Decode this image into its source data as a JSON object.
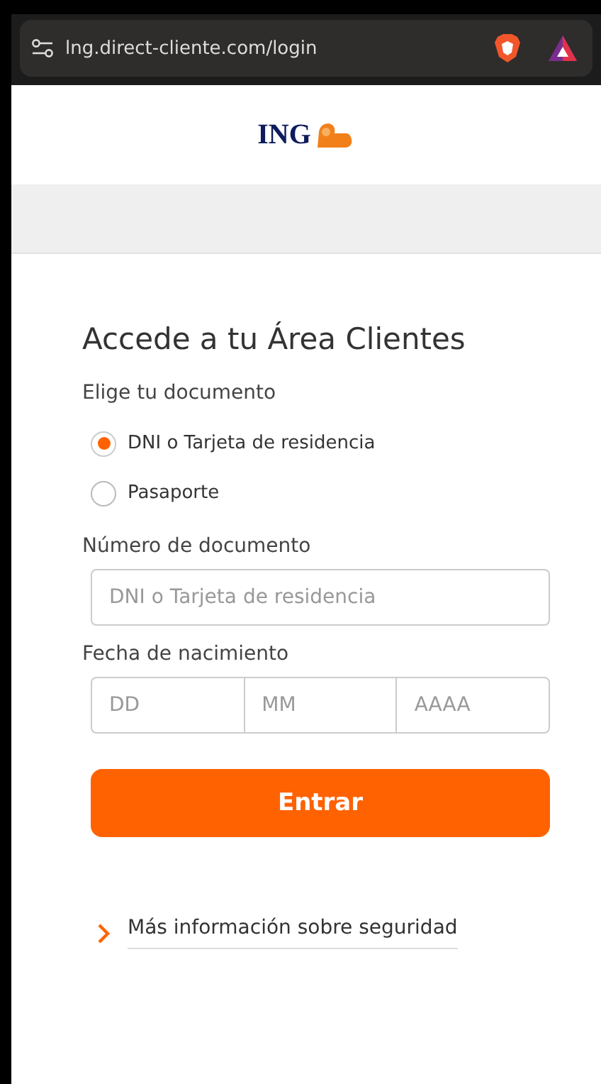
{
  "browser": {
    "url": "lng.direct-cliente.com/login"
  },
  "header": {
    "logo_text": "ING"
  },
  "form": {
    "title": "Accede a tu Área Clientes",
    "document_label": "Elige tu documento",
    "document_options": [
      {
        "label": "DNI o Tarjeta de residencia",
        "selected": true
      },
      {
        "label": "Pasaporte",
        "selected": false
      }
    ],
    "number_label": "Número de documento",
    "number_placeholder": "DNI o Tarjeta de residencia",
    "birth_label": "Fecha de nacimiento",
    "birth_fields": [
      {
        "placeholder": "DD"
      },
      {
        "placeholder": "MM"
      },
      {
        "placeholder": "AAAA"
      }
    ],
    "submit": "Entrar",
    "security_link": "Más información sobre seguridad"
  }
}
